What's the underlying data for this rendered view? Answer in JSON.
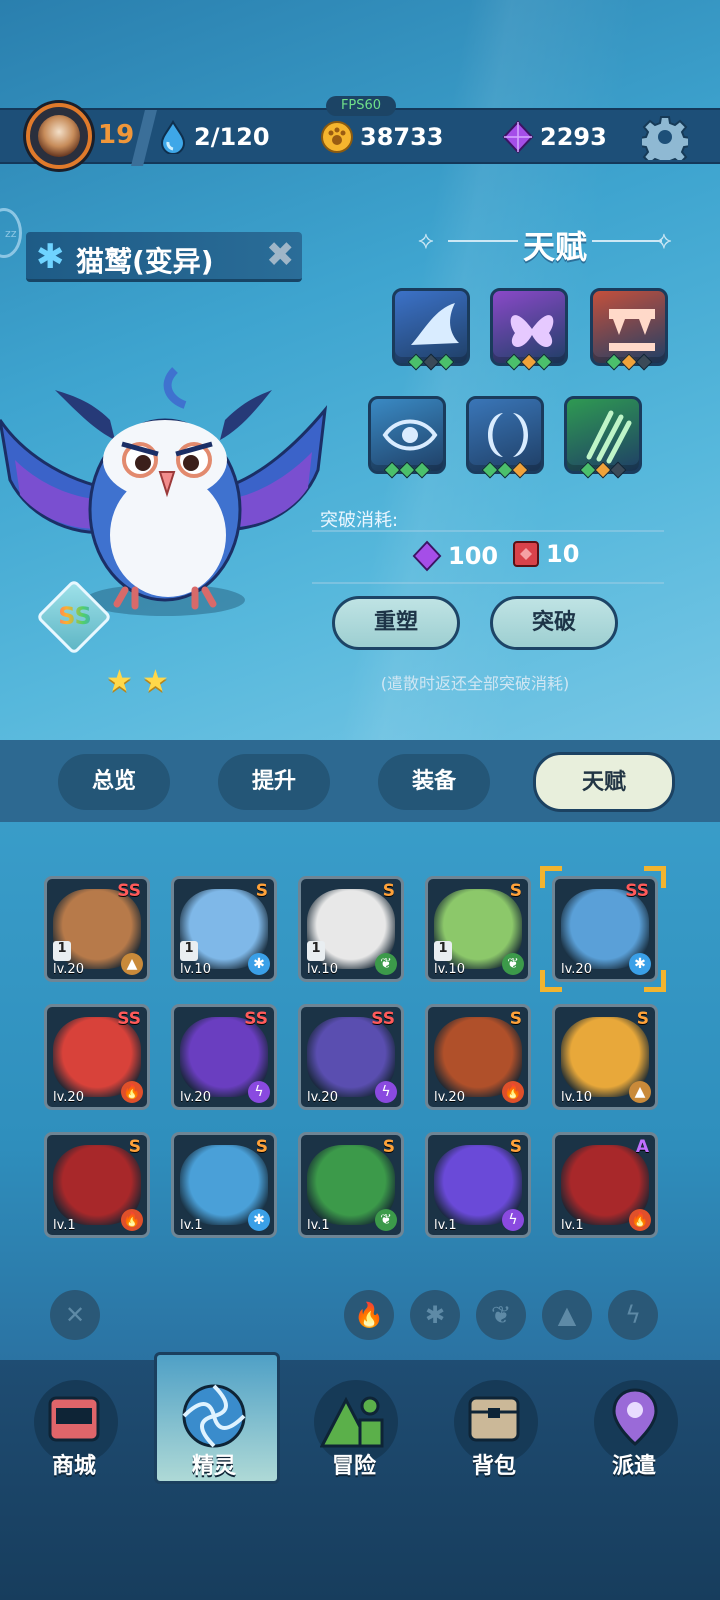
{
  "header": {
    "level": "19",
    "energy": "2/120",
    "gold": "38733",
    "gems": "2293",
    "fps": "FPS60"
  },
  "pet": {
    "name": "猫鹫(变异)",
    "rank": "SS",
    "stars": 2
  },
  "talent": {
    "title": "天赋",
    "skills": [
      {
        "icon": "shark-fin-icon",
        "color": "#3c72c8",
        "pips": [
          "#4bc06b",
          "#3b4a58",
          "#4bc06b"
        ]
      },
      {
        "icon": "butterfly-icon",
        "color": "#8a49c8",
        "pips": [
          "#4bc06b",
          "#f0a23a",
          "#4bc06b"
        ]
      },
      {
        "icon": "fangs-icon",
        "color": "#c4503c",
        "pips": [
          "#4bc06b",
          "#f0a23a",
          "#3b4a58"
        ]
      },
      {
        "icon": "eye-icon",
        "color": "#3a8ac4",
        "pips": [
          "#4bc06b",
          "#4bc06b",
          "#4bc06b"
        ]
      },
      {
        "icon": "crescent-icon",
        "color": "#3a76b8",
        "pips": [
          "#4bc06b",
          "#4bc06b",
          "#f0a23a"
        ]
      },
      {
        "icon": "claw-icon",
        "color": "#2f9a52",
        "pips": [
          "#4bc06b",
          "#f0a23a",
          "#3b4a58"
        ]
      }
    ],
    "breach_label": "突破消耗:",
    "cost_gems": "100",
    "cost_item": "10",
    "reshape_button": "重塑",
    "breach_button": "突破",
    "note": "(遣散时返还全部突破消耗)"
  },
  "tabs": [
    "总览",
    "提升",
    "装备",
    "天赋"
  ],
  "pets": [
    {
      "grade": "SS",
      "level": "lv.20",
      "count": "1",
      "element": "earth",
      "color": "#b77a4a",
      "gradeColor": "#ff5a5a"
    },
    {
      "grade": "S",
      "level": "lv.10",
      "count": "1",
      "element": "ice",
      "color": "#7fb8e8",
      "gradeColor": "#ffa23a"
    },
    {
      "grade": "S",
      "level": "lv.10",
      "count": "1",
      "element": "leaf",
      "color": "#e8e8e8",
      "gradeColor": "#ffa23a"
    },
    {
      "grade": "S",
      "level": "lv.10",
      "count": "1",
      "element": "leaf",
      "color": "#8cc86a",
      "gradeColor": "#ffa23a"
    },
    {
      "grade": "SS",
      "level": "lv.20",
      "count": "",
      "element": "ice",
      "color": "#5aa0d8",
      "gradeColor": "#ff5a5a"
    },
    {
      "grade": "SS",
      "level": "lv.20",
      "count": "",
      "element": "fire",
      "color": "#d8423a",
      "gradeColor": "#ff5a5a"
    },
    {
      "grade": "SS",
      "level": "lv.20",
      "count": "",
      "element": "thunder",
      "color": "#6a3ec0",
      "gradeColor": "#ff5a5a"
    },
    {
      "grade": "SS",
      "level": "lv.20",
      "count": "",
      "element": "thunder",
      "color": "#5a4eb0",
      "gradeColor": "#ff5a5a"
    },
    {
      "grade": "S",
      "level": "lv.20",
      "count": "",
      "element": "fire",
      "color": "#b0502a",
      "gradeColor": "#ffa23a"
    },
    {
      "grade": "S",
      "level": "lv.10",
      "count": "",
      "element": "earth",
      "color": "#e8a83a",
      "gradeColor": "#ffa23a"
    },
    {
      "grade": "S",
      "level": "lv.1",
      "count": "",
      "element": "fire",
      "color": "#a8282a",
      "gradeColor": "#ffa23a"
    },
    {
      "grade": "S",
      "level": "lv.1",
      "count": "",
      "element": "ice",
      "color": "#4aa0d8",
      "gradeColor": "#ffa23a"
    },
    {
      "grade": "S",
      "level": "lv.1",
      "count": "",
      "element": "leaf",
      "color": "#3c9a4a",
      "gradeColor": "#ffa23a"
    },
    {
      "grade": "S",
      "level": "lv.1",
      "count": "",
      "element": "thunder",
      "color": "#6a4ad8",
      "gradeColor": "#ffa23a"
    },
    {
      "grade": "A",
      "level": "lv.1",
      "count": "",
      "element": "fire",
      "color": "#a8282a",
      "gradeColor": "#c070ff"
    }
  ],
  "filters": [
    "clear-filter-icon",
    "fire-filter-icon",
    "ice-filter-icon",
    "leaf-filter-icon",
    "earth-filter-icon",
    "thunder-filter-icon"
  ],
  "nav": [
    "商城",
    "精灵",
    "冒险",
    "背包",
    "派遣"
  ]
}
